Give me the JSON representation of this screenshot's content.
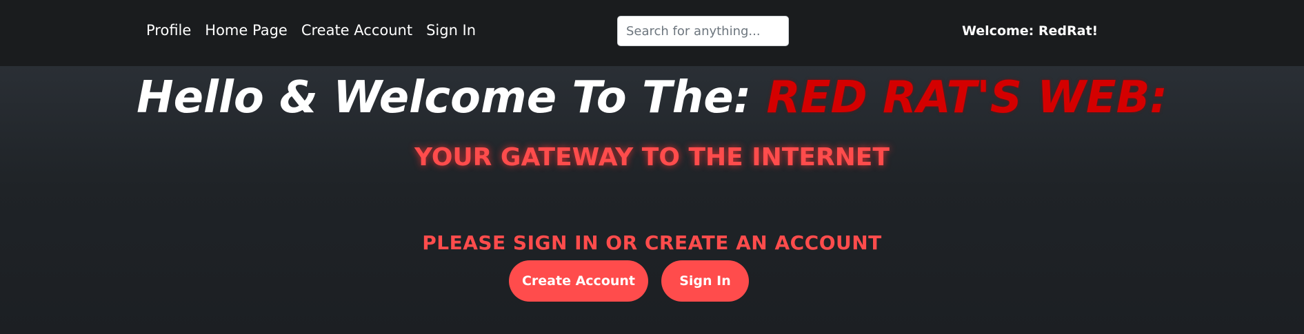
{
  "navbar": {
    "links": [
      "Profile",
      "Home Page",
      "Create Account",
      "Sign In"
    ],
    "search_placeholder": "Search for anything...",
    "welcome_text": "Welcome: RedRat!"
  },
  "hero": {
    "title_prefix": "Hello & Welcome To The:",
    "title_brand": "RED RAT'S WEB:",
    "subtitle": "YOUR GATEWAY TO THE INTERNET",
    "prompt": "PLEASE SIGN IN OR CREATE AN ACCOUNT",
    "create_account_label": "Create Account",
    "sign_in_label": "Sign In"
  },
  "colors": {
    "navbar_bg": "#1a1c1e",
    "page_bg": "#1c1f23",
    "brand_red": "#d40000",
    "accent_red": "#ff4c4c",
    "text_white": "#ffffff"
  }
}
